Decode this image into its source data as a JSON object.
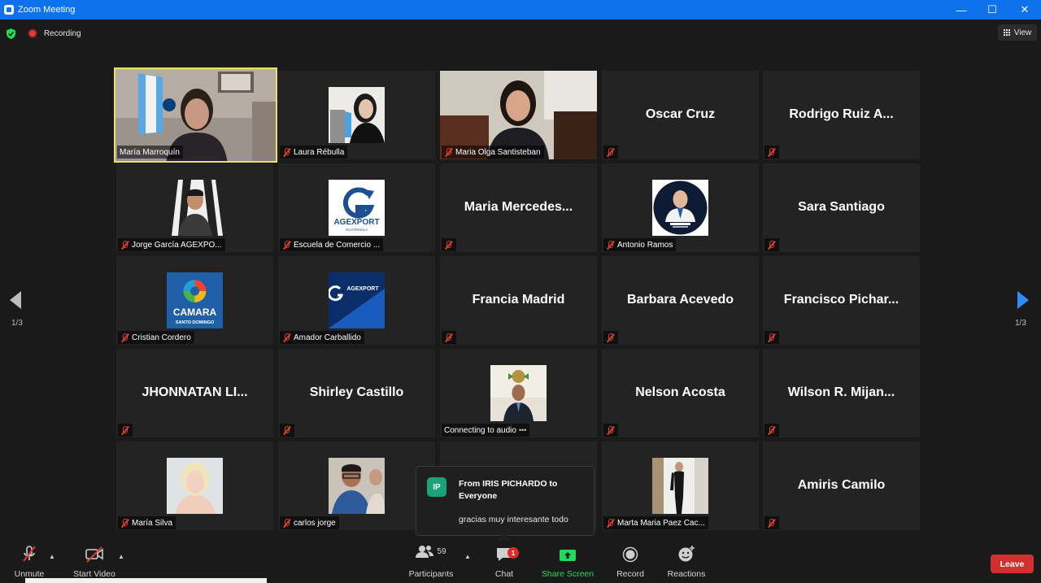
{
  "window": {
    "title": "Zoom Meeting",
    "minimize_icon": "minimize-icon",
    "maximize_icon": "maximize-icon",
    "close_icon": "close-icon"
  },
  "status": {
    "recording_label": "Recording",
    "view_label": "View"
  },
  "pagination": {
    "left": "1/3",
    "right": "1/3"
  },
  "participants": [
    {
      "name": "María Marroquín",
      "type": "video",
      "active": true
    },
    {
      "name": "Laura Rébulla",
      "type": "avatar",
      "muted": true
    },
    {
      "name": "Maria Olga Santisteban",
      "type": "video",
      "muted": true
    },
    {
      "big": "Oscar Cruz",
      "type": "name",
      "muted": true
    },
    {
      "big": "Rodrigo Ruiz A...",
      "type": "name",
      "muted": true
    },
    {
      "name": "Jorge García AGEXPO...",
      "type": "avatar",
      "muted": true
    },
    {
      "name": "Escuela de Comercio ...",
      "type": "avatar",
      "muted": true,
      "logo_text": "AGEXPORT",
      "logo_sub": "GUATEMALA"
    },
    {
      "big": "Maria  Mercedes...",
      "type": "name",
      "muted": true
    },
    {
      "name": "Antonio Ramos",
      "type": "avatar",
      "muted": true
    },
    {
      "big": "Sara Santiago",
      "type": "name",
      "muted": true
    },
    {
      "name": "Cristian Cordero",
      "type": "avatar",
      "muted": true,
      "logo_text": "CAMARA",
      "logo_sub": "SANTO DOMINGO"
    },
    {
      "name": "Amador Carballido",
      "type": "avatar",
      "muted": true,
      "logo_text": "AGEXPORT"
    },
    {
      "big": "Francia Madrid",
      "type": "name",
      "muted": true
    },
    {
      "big": "Barbara Acevedo",
      "type": "name",
      "muted": true
    },
    {
      "big": "Francisco  Pichar...",
      "type": "name",
      "muted": true
    },
    {
      "big": "JHONNATAN  LI...",
      "type": "name",
      "muted": true
    },
    {
      "big": "Shirley Castillo",
      "type": "name",
      "muted": true
    },
    {
      "name": "Connecting to audio",
      "type": "avatar",
      "connecting": true
    },
    {
      "big": "Nelson Acosta",
      "type": "name",
      "muted": true
    },
    {
      "big": "Wilson  R.  Mijan...",
      "type": "name",
      "muted": true
    },
    {
      "name": "María Silva",
      "type": "avatar",
      "muted": true
    },
    {
      "name": "carlos jorge",
      "type": "avatar",
      "muted": true
    },
    {
      "name": "",
      "type": "hidden"
    },
    {
      "name": "Marta Maria Paez Cac...",
      "type": "avatar",
      "muted": true
    },
    {
      "big": "Amiris Camilo",
      "type": "name",
      "muted": true
    }
  ],
  "chat_popup": {
    "initials": "IP",
    "from": "From IRIS PICHARDO to Everyone",
    "message": "gracias muy interesante todo"
  },
  "toolbar": {
    "unmute": "Unmute",
    "start_video": "Start Video",
    "participants": "Participants",
    "participants_count": "59",
    "chat": "Chat",
    "chat_badge": "1",
    "share_screen": "Share Screen",
    "record": "Record",
    "reactions": "Reactions",
    "leave": "Leave"
  },
  "colors": {
    "accent": "#0e72ed",
    "share_green": "#23d959",
    "leave_red": "#d42f2f",
    "active_border": "#e7e36d",
    "muted_red": "#e03e2d"
  }
}
